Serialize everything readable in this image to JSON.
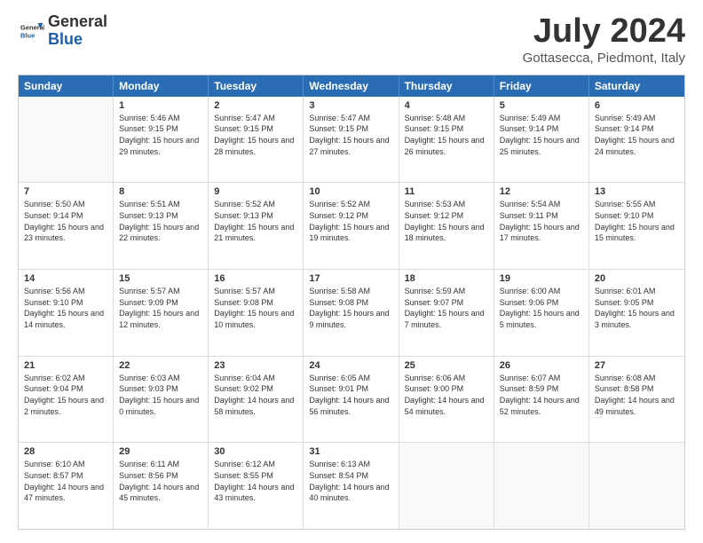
{
  "header": {
    "logo": {
      "line1": "General",
      "line2": "Blue"
    },
    "title": "July 2024",
    "subtitle": "Gottasecca, Piedmont, Italy"
  },
  "weekdays": [
    "Sunday",
    "Monday",
    "Tuesday",
    "Wednesday",
    "Thursday",
    "Friday",
    "Saturday"
  ],
  "weeks": [
    [
      {
        "day": "",
        "empty": true
      },
      {
        "day": "1",
        "sunrise": "5:46 AM",
        "sunset": "9:15 PM",
        "daylight": "15 hours and 29 minutes."
      },
      {
        "day": "2",
        "sunrise": "5:47 AM",
        "sunset": "9:15 PM",
        "daylight": "15 hours and 28 minutes."
      },
      {
        "day": "3",
        "sunrise": "5:47 AM",
        "sunset": "9:15 PM",
        "daylight": "15 hours and 27 minutes."
      },
      {
        "day": "4",
        "sunrise": "5:48 AM",
        "sunset": "9:15 PM",
        "daylight": "15 hours and 26 minutes."
      },
      {
        "day": "5",
        "sunrise": "5:49 AM",
        "sunset": "9:14 PM",
        "daylight": "15 hours and 25 minutes."
      },
      {
        "day": "6",
        "sunrise": "5:49 AM",
        "sunset": "9:14 PM",
        "daylight": "15 hours and 24 minutes."
      }
    ],
    [
      {
        "day": "7",
        "sunrise": "5:50 AM",
        "sunset": "9:14 PM",
        "daylight": "15 hours and 23 minutes."
      },
      {
        "day": "8",
        "sunrise": "5:51 AM",
        "sunset": "9:13 PM",
        "daylight": "15 hours and 22 minutes."
      },
      {
        "day": "9",
        "sunrise": "5:52 AM",
        "sunset": "9:13 PM",
        "daylight": "15 hours and 21 minutes."
      },
      {
        "day": "10",
        "sunrise": "5:52 AM",
        "sunset": "9:12 PM",
        "daylight": "15 hours and 19 minutes."
      },
      {
        "day": "11",
        "sunrise": "5:53 AM",
        "sunset": "9:12 PM",
        "daylight": "15 hours and 18 minutes."
      },
      {
        "day": "12",
        "sunrise": "5:54 AM",
        "sunset": "9:11 PM",
        "daylight": "15 hours and 17 minutes."
      },
      {
        "day": "13",
        "sunrise": "5:55 AM",
        "sunset": "9:10 PM",
        "daylight": "15 hours and 15 minutes."
      }
    ],
    [
      {
        "day": "14",
        "sunrise": "5:56 AM",
        "sunset": "9:10 PM",
        "daylight": "15 hours and 14 minutes."
      },
      {
        "day": "15",
        "sunrise": "5:57 AM",
        "sunset": "9:09 PM",
        "daylight": "15 hours and 12 minutes."
      },
      {
        "day": "16",
        "sunrise": "5:57 AM",
        "sunset": "9:08 PM",
        "daylight": "15 hours and 10 minutes."
      },
      {
        "day": "17",
        "sunrise": "5:58 AM",
        "sunset": "9:08 PM",
        "daylight": "15 hours and 9 minutes."
      },
      {
        "day": "18",
        "sunrise": "5:59 AM",
        "sunset": "9:07 PM",
        "daylight": "15 hours and 7 minutes."
      },
      {
        "day": "19",
        "sunrise": "6:00 AM",
        "sunset": "9:06 PM",
        "daylight": "15 hours and 5 minutes."
      },
      {
        "day": "20",
        "sunrise": "6:01 AM",
        "sunset": "9:05 PM",
        "daylight": "15 hours and 3 minutes."
      }
    ],
    [
      {
        "day": "21",
        "sunrise": "6:02 AM",
        "sunset": "9:04 PM",
        "daylight": "15 hours and 2 minutes."
      },
      {
        "day": "22",
        "sunrise": "6:03 AM",
        "sunset": "9:03 PM",
        "daylight": "15 hours and 0 minutes."
      },
      {
        "day": "23",
        "sunrise": "6:04 AM",
        "sunset": "9:02 PM",
        "daylight": "14 hours and 58 minutes."
      },
      {
        "day": "24",
        "sunrise": "6:05 AM",
        "sunset": "9:01 PM",
        "daylight": "14 hours and 56 minutes."
      },
      {
        "day": "25",
        "sunrise": "6:06 AM",
        "sunset": "9:00 PM",
        "daylight": "14 hours and 54 minutes."
      },
      {
        "day": "26",
        "sunrise": "6:07 AM",
        "sunset": "8:59 PM",
        "daylight": "14 hours and 52 minutes."
      },
      {
        "day": "27",
        "sunrise": "6:08 AM",
        "sunset": "8:58 PM",
        "daylight": "14 hours and 49 minutes."
      }
    ],
    [
      {
        "day": "28",
        "sunrise": "6:10 AM",
        "sunset": "8:57 PM",
        "daylight": "14 hours and 47 minutes."
      },
      {
        "day": "29",
        "sunrise": "6:11 AM",
        "sunset": "8:56 PM",
        "daylight": "14 hours and 45 minutes."
      },
      {
        "day": "30",
        "sunrise": "6:12 AM",
        "sunset": "8:55 PM",
        "daylight": "14 hours and 43 minutes."
      },
      {
        "day": "31",
        "sunrise": "6:13 AM",
        "sunset": "8:54 PM",
        "daylight": "14 hours and 40 minutes."
      },
      {
        "day": "",
        "empty": true
      },
      {
        "day": "",
        "empty": true
      },
      {
        "day": "",
        "empty": true
      }
    ]
  ]
}
